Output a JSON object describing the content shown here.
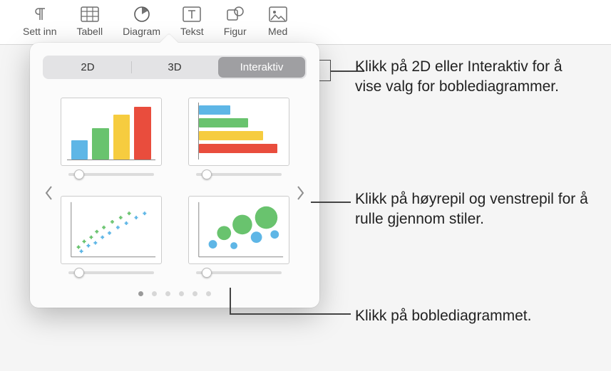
{
  "toolbar": {
    "items": [
      {
        "label": "Sett inn",
        "icon": "insert-icon"
      },
      {
        "label": "Tabell",
        "icon": "table-icon"
      },
      {
        "label": "Diagram",
        "icon": "chart-icon",
        "active": true
      },
      {
        "label": "Tekst",
        "icon": "text-icon"
      },
      {
        "label": "Figur",
        "icon": "shape-icon"
      },
      {
        "label": "Med",
        "icon": "media-icon"
      }
    ]
  },
  "popover": {
    "tabs": {
      "t0": "2D",
      "t1": "3D",
      "t2": "Interaktiv",
      "selected": 2
    },
    "charts": [
      {
        "name": "interactive-column-chart"
      },
      {
        "name": "interactive-bar-chart"
      },
      {
        "name": "interactive-scatter-chart"
      },
      {
        "name": "interactive-bubble-chart"
      }
    ],
    "page_count": 6,
    "page_index": 0
  },
  "annotations": {
    "a1": "Klikk på 2D eller Interaktiv for å vise valg for boblediagrammer.",
    "a2": "Klikk på høyrepil og venstrepil for å rulle gjennom stiler.",
    "a3": "Klikk på boblediagrammet."
  }
}
